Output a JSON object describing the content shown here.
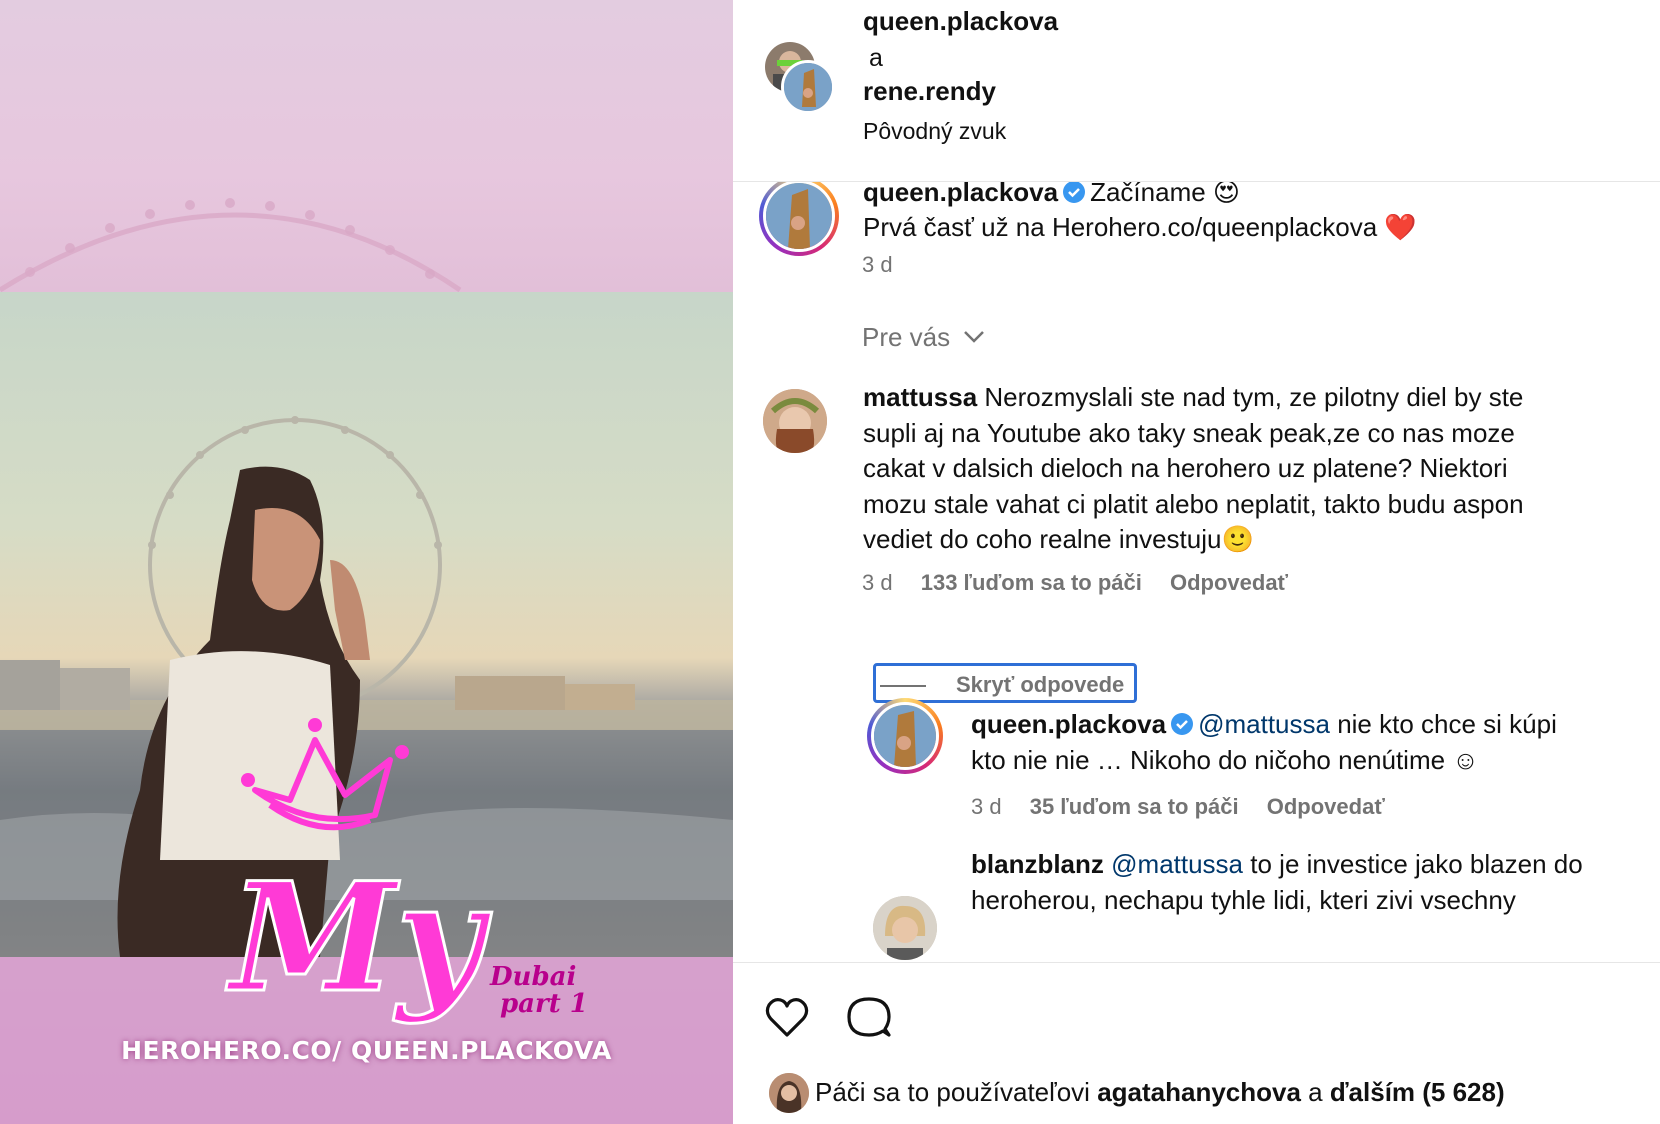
{
  "post": {
    "media": {
      "overlay_title": "My",
      "overlay_subtitle_1": "Dubai",
      "overlay_subtitle_2": "part 1",
      "overlay_url": "HEROHERO.CO/ QUEEN.PLACKOVA"
    },
    "header": {
      "user_1": "queen.plackova",
      "conjunction": "a",
      "user_2": "rene.rendy",
      "audio": "Pôvodný zvuk"
    },
    "caption": {
      "username": "queen.plackova",
      "text_1": "Začíname 😍",
      "text_2": "Prvá časť už na Herohero.co/queenplackova ❤️",
      "time": "3 d"
    },
    "filter_label": "Pre vás",
    "comments": [
      {
        "username": "mattussa",
        "lines": [
          "Nerozmyslali ste nad tym, ze pilotny diel by ste",
          "supli aj na Youtube ako taky sneak peak,ze co nas moze",
          "cakat v dalsich dieloch na herohero uz platene? Niektori",
          "mozu stale vahat ci platit alebo neplatit, takto budu aspon",
          "vediet do coho realne investuju🙂"
        ],
        "time": "3 d",
        "likes": "133 ľuďom sa to páči",
        "reply": "Odpovedať"
      }
    ],
    "hide_replies": "Skryť odpovede",
    "replies": [
      {
        "username": "queen.plackova",
        "mention": "@mattussa",
        "text_1": " nie kto chce si kúpi",
        "text_2": "kto nie nie … Nikoho do ničoho nenútime ☺",
        "time": "3 d",
        "likes": "35 ľuďom sa to páči",
        "reply": "Odpovedať"
      },
      {
        "username": "blanzblanz",
        "mention": "@mattussa",
        "text_1": " to je investice jako blazen do",
        "text_2": "heroherou, nechapu tyhle lidi, kteri zivi vsechny"
      }
    ],
    "actions": {
      "like_icon": "heart-icon",
      "comment_icon": "comment-icon"
    },
    "likes_summary": {
      "prefix": "Páči sa to používateľovi ",
      "user": "agatahanychova",
      "middle": " a ",
      "others": "ďalším (5 628)"
    }
  },
  "colors": {
    "verified": "#3897f0",
    "mention": "#00376b",
    "meta": "#737373",
    "neon_pink": "#ff3ad6"
  }
}
